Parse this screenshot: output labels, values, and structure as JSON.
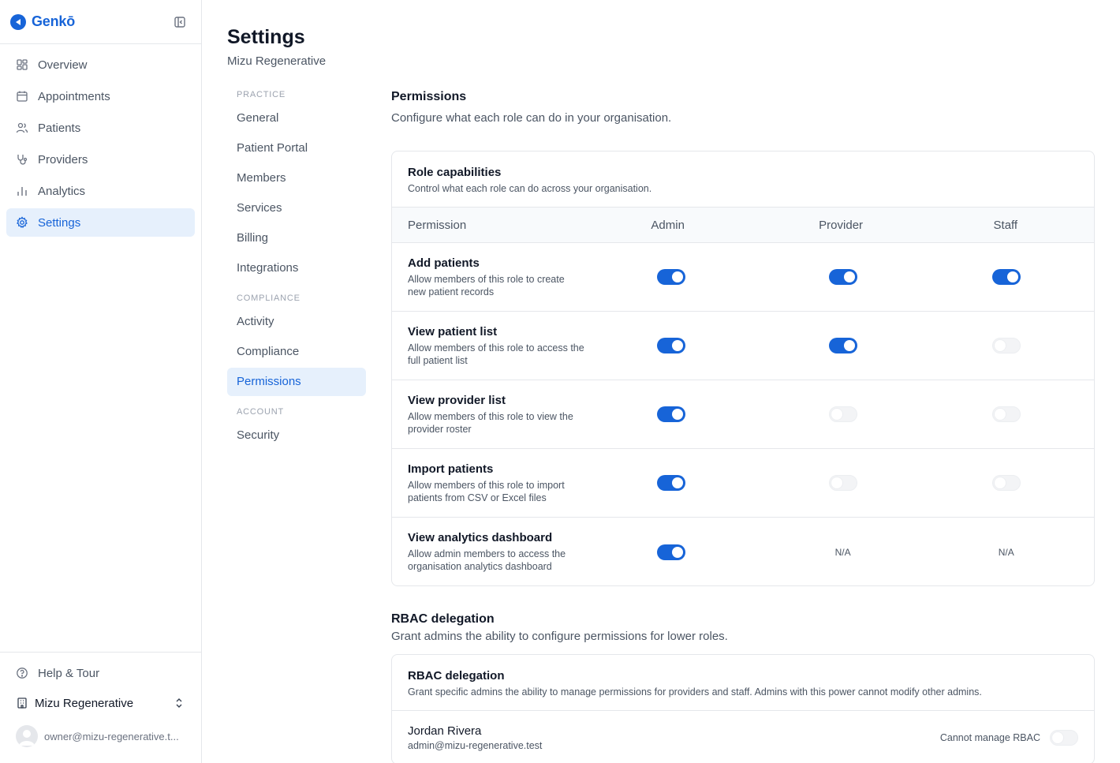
{
  "brand": {
    "name": "Genkō"
  },
  "sidebar": {
    "items": [
      {
        "label": "Overview",
        "icon": "grid-icon",
        "active": false
      },
      {
        "label": "Appointments",
        "icon": "calendar-icon",
        "active": false
      },
      {
        "label": "Patients",
        "icon": "users-icon",
        "active": false
      },
      {
        "label": "Providers",
        "icon": "stethoscope-icon",
        "active": false
      },
      {
        "label": "Analytics",
        "icon": "bar-chart-icon",
        "active": false
      },
      {
        "label": "Settings",
        "icon": "gear-icon",
        "active": true
      }
    ],
    "help_label": "Help & Tour",
    "org_name": "Mizu Regenerative",
    "user_email": "owner@mizu-regenerative.t..."
  },
  "page": {
    "title": "Settings",
    "subtitle": "Mizu Regenerative"
  },
  "subnav": {
    "groups": [
      {
        "label": "PRACTICE",
        "items": [
          "General",
          "Patient Portal",
          "Members",
          "Services",
          "Billing",
          "Integrations"
        ]
      },
      {
        "label": "COMPLIANCE",
        "items": [
          "Activity",
          "Compliance",
          "Permissions"
        ]
      },
      {
        "label": "ACCOUNT",
        "items": [
          "Security"
        ]
      }
    ],
    "active": "Permissions"
  },
  "permissions": {
    "title": "Permissions",
    "description": "Configure what each role can do in your organisation.",
    "card": {
      "title": "Role capabilities",
      "description": "Control what each role can do across your organisation.",
      "columns": [
        "Permission",
        "Admin",
        "Provider",
        "Staff"
      ],
      "rows": [
        {
          "name": "Add patients",
          "description": "Allow members of this role to create new patient records",
          "admin": "on",
          "provider": "on",
          "staff": "on"
        },
        {
          "name": "View patient list",
          "description": "Allow members of this role to access the full patient list",
          "admin": "on",
          "provider": "on",
          "staff": "off"
        },
        {
          "name": "View provider list",
          "description": "Allow members of this role to view the provider roster",
          "admin": "on",
          "provider": "off",
          "staff": "off"
        },
        {
          "name": "Import patients",
          "description": "Allow members of this role to import patients from CSV or Excel files",
          "admin": "on",
          "provider": "off",
          "staff": "off"
        },
        {
          "name": "View analytics dashboard",
          "description": "Allow admin members to access the organisation analytics dashboard",
          "admin": "on",
          "provider": "N/A",
          "staff": "N/A"
        }
      ]
    }
  },
  "rbac": {
    "title": "RBAC delegation",
    "description": "Grant admins the ability to configure permissions for lower roles.",
    "card": {
      "title": "RBAC delegation",
      "description": "Grant specific admins the ability to manage permissions for providers and staff. Admins with this power cannot modify other admins."
    },
    "users": [
      {
        "name": "Jordan Rivera",
        "email": "admin@mizu-regenerative.test",
        "status": "Cannot manage RBAC",
        "enabled": false
      }
    ]
  },
  "colors": {
    "accent": "#1764d8",
    "active_bg": "#e6f0fc",
    "border": "#e5e7eb"
  }
}
